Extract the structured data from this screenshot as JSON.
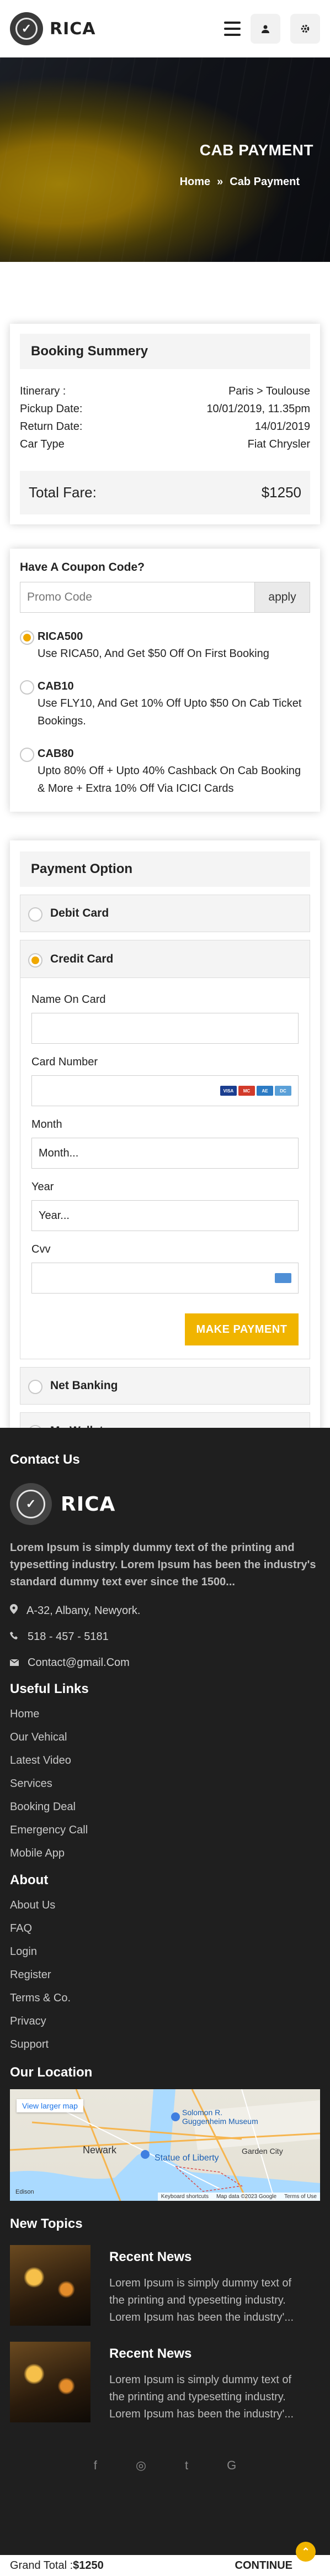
{
  "header": {
    "brand": "RICA"
  },
  "hero": {
    "title": "CAB PAYMENT",
    "crumb_home": "Home",
    "crumb_sep": "»",
    "crumb_current": "Cab Payment"
  },
  "booking": {
    "title": "Booking Summery",
    "rows": [
      {
        "label": "Itinerary :",
        "value": "Paris > Toulouse"
      },
      {
        "label": "Pickup Date:",
        "value": "10/01/2019, 11.35pm"
      },
      {
        "label": "Return Date:",
        "value": "14/01/2019"
      },
      {
        "label": "Car Type",
        "value": "Fiat Chrysler"
      }
    ],
    "total_label": "Total Fare:",
    "total_value": "$1250"
  },
  "coupon": {
    "title": "Have A Coupon Code?",
    "placeholder": "Promo Code",
    "apply": "apply",
    "options": [
      {
        "code": "RICA500",
        "desc": "Use RICA50, And Get $50 Off On First Booking",
        "selected": true
      },
      {
        "code": "CAB10",
        "desc": "Use FLY10, And Get 10% Off Upto $50 On Cab Ticket Bookings.",
        "selected": false
      },
      {
        "code": "CAB80",
        "desc": "Upto 80% Off + Upto 40% Cashback On Cab Booking & More + Extra 10% Off Via ICICI Cards",
        "selected": false
      }
    ]
  },
  "payment": {
    "title": "Payment Option",
    "debit": "Debit Card",
    "credit": "Credit Card",
    "name_label": "Name On Card",
    "number_label": "Card Number",
    "month_label": "Month",
    "month_value": "Month...",
    "year_label": "Year",
    "year_value": "Year...",
    "cvv_label": "Cvv",
    "make_payment": "MAKE PAYMENT",
    "net_banking": "Net Banking",
    "wallet": "My Wallet"
  },
  "footer": {
    "contact_title": "Contact Us",
    "brand": "RICA",
    "about": "Lorem Ipsum is simply dummy text of the printing and typesetting industry. Lorem Ipsum has been the industry's standard dummy text ever since the 1500...",
    "address": "A-32, Albany, Newyork.",
    "phone": "518 - 457 - 5181",
    "email": "Contact@gmail.Com",
    "useful_title": "Useful Links",
    "useful_links": [
      "Home",
      "Our Vehical",
      "Latest Video",
      "Services",
      "Booking Deal",
      "Emergency Call",
      "Mobile App"
    ],
    "about_title": "About",
    "about_links": [
      "About Us",
      "FAQ",
      "Login",
      "Register",
      "Terms & Co.",
      "Privacy",
      "Support"
    ],
    "location_title": "Our Location",
    "map_link": "View larger map",
    "map_labels": {
      "newark": "Newark",
      "statue": "Statue of Liberty",
      "guggenheim": "Solomon R. Guggenheim Museum",
      "garden_city": "Garden City",
      "edison": "Edison",
      "shortcuts": "Keyboard shortcuts",
      "mapdata": "Map data ©2023 Google",
      "terms": "Terms of Use"
    },
    "news_title": "New Topics",
    "news": [
      {
        "title": "Recent News",
        "desc": "Lorem Ipsum is simply dummy text of the printing and typesetting industry. Lorem Ipsum has been the industry'..."
      },
      {
        "title": "Recent News",
        "desc": "Lorem Ipsum is simply dummy text of the printing and typesetting industry. Lorem Ipsum has been the industry'..."
      }
    ],
    "socials": [
      "f",
      "◎",
      "t",
      "G"
    ]
  },
  "bottom": {
    "grand_total_label": "Grand Total :",
    "grand_total_value": "$1250",
    "continue": "CONTINUE"
  },
  "colors": {
    "accent": "#f0b400",
    "footer_bg": "#1f1f1f"
  }
}
